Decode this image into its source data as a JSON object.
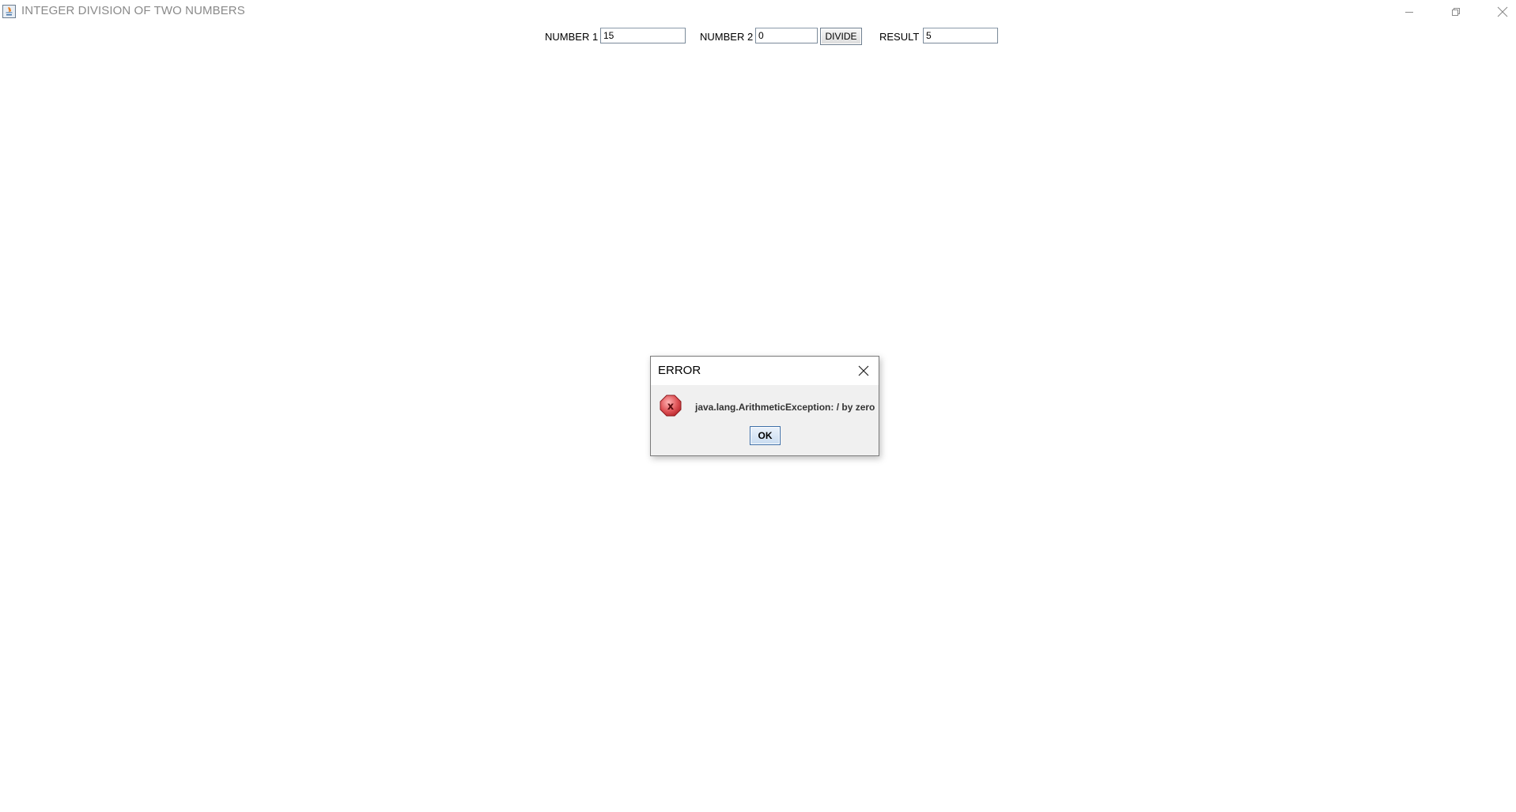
{
  "window": {
    "title": "INTEGER DIVISION OF TWO NUMBERS",
    "icon": "java-icon",
    "controls": [
      "minimize-icon",
      "maximize-icon",
      "close-icon"
    ]
  },
  "form": {
    "number1_label": "NUMBER 1",
    "number1_value": "15",
    "number2_label": "NUMBER 2",
    "number2_value": "0",
    "divide_label": "DIVIDE",
    "result_label": "RESULT",
    "result_value": "5"
  },
  "dialog": {
    "title": "ERROR",
    "icon": "error-icon",
    "message": "java.lang.ArithmeticException: / by zero",
    "ok_label": "OK"
  },
  "colors": {
    "error_icon": "#d9262b",
    "ok_border": "#3c6ea8"
  }
}
